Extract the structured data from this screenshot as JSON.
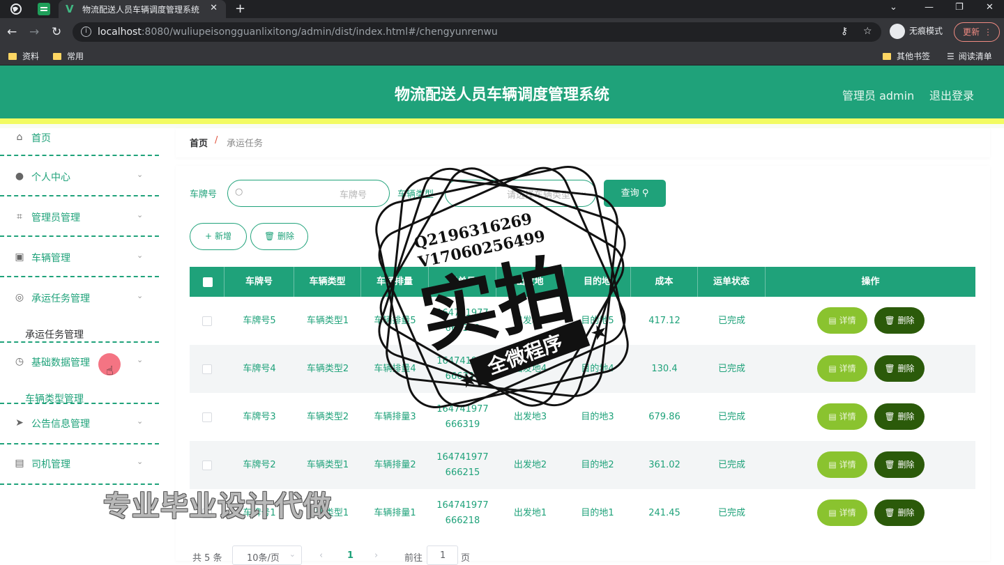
{
  "browser": {
    "tab_title": "物流配送人员车辆调度管理系统",
    "url_host": "localhost",
    "url_rest": ":8080/wuliupeisongguanlixitong/admin/dist/index.html#/chengyunrenwu",
    "incognito_label": "无痕模式",
    "update_label": "更新",
    "bookmarks": [
      "资料",
      "常用"
    ],
    "other_bookmarks": "其他书签",
    "reading_list": "阅读清单"
  },
  "header": {
    "title": "物流配送人员车辆调度管理系统",
    "user": "管理员 admin",
    "logout": "退出登录"
  },
  "sidebar": {
    "items": [
      {
        "label": "首页",
        "icon": "home-icon"
      },
      {
        "label": "个人中心",
        "icon": "user-icon"
      },
      {
        "label": "管理员管理",
        "icon": "crop-icon"
      },
      {
        "label": "车辆管理",
        "icon": "clipboard-icon"
      },
      {
        "label": "承运任务管理",
        "icon": "target-icon"
      },
      {
        "label": "基础数据管理",
        "icon": "compass-icon"
      },
      {
        "label": "公告信息管理",
        "icon": "send-icon"
      },
      {
        "label": "司机管理",
        "icon": "list-icon"
      }
    ],
    "sub_task": "承运任务管理",
    "sub_basic": "车辆类型管理"
  },
  "breadcrumb": {
    "home": "首页",
    "sep": "/",
    "current": "承运任务"
  },
  "filters": {
    "plate_label": "车牌号",
    "plate_placeholder": "车牌号",
    "type_label": "车辆类型",
    "type_placeholder": "请选择车辆类型",
    "query": "查询"
  },
  "actions": {
    "add": "新增",
    "delete": "删除"
  },
  "table": {
    "headers": [
      "车牌号",
      "车辆类型",
      "车辆排量",
      "运单号",
      "出发地",
      "目的地",
      "成本",
      "运单状态",
      "操作"
    ],
    "rows": [
      {
        "plate": "车牌号5",
        "type": "车辆类型1",
        "disp": "车辆排量5",
        "waybill": "164741977 666330",
        "from": "出发地5",
        "to": "目的地5",
        "cost": "417.12",
        "status": "已完成"
      },
      {
        "plate": "车牌号4",
        "type": "车辆类型2",
        "disp": "车辆排量4",
        "waybill": "164741977 666324",
        "from": "出发地4",
        "to": "目的地4",
        "cost": "130.4",
        "status": "已完成"
      },
      {
        "plate": "车牌号3",
        "type": "车辆类型2",
        "disp": "车辆排量3",
        "waybill": "164741977 666319",
        "from": "出发地3",
        "to": "目的地3",
        "cost": "679.86",
        "status": "已完成"
      },
      {
        "plate": "车牌号2",
        "type": "车辆类型1",
        "disp": "车辆排量2",
        "waybill": "164741977 666215",
        "from": "出发地2",
        "to": "目的地2",
        "cost": "361.02",
        "status": "已完成"
      },
      {
        "plate": "车牌号1",
        "type": "车辆类型1",
        "disp": "车辆排量1",
        "waybill": "164741977 666218",
        "from": "出发地1",
        "to": "目的地1",
        "cost": "241.45",
        "status": "已完成"
      }
    ],
    "detail_label": "详情",
    "delete_label": "删除"
  },
  "pagination": {
    "total": "共 5 条",
    "page_size": "10条/页",
    "current_page": "1",
    "goto_prefix": "前往",
    "goto_value": "1",
    "goto_suffix": "页"
  },
  "watermark": {
    "qq": "Q2196316269",
    "wechat": "V17060256499",
    "big": "实拍",
    "ribbon": "全微程序",
    "promo": "专业毕业设计代做"
  },
  "colors": {
    "primary": "#1fa27a",
    "accent_yellow": "#f2fb61",
    "detail_btn": "#8ac32f",
    "delete_btn": "#2b5a0a"
  }
}
